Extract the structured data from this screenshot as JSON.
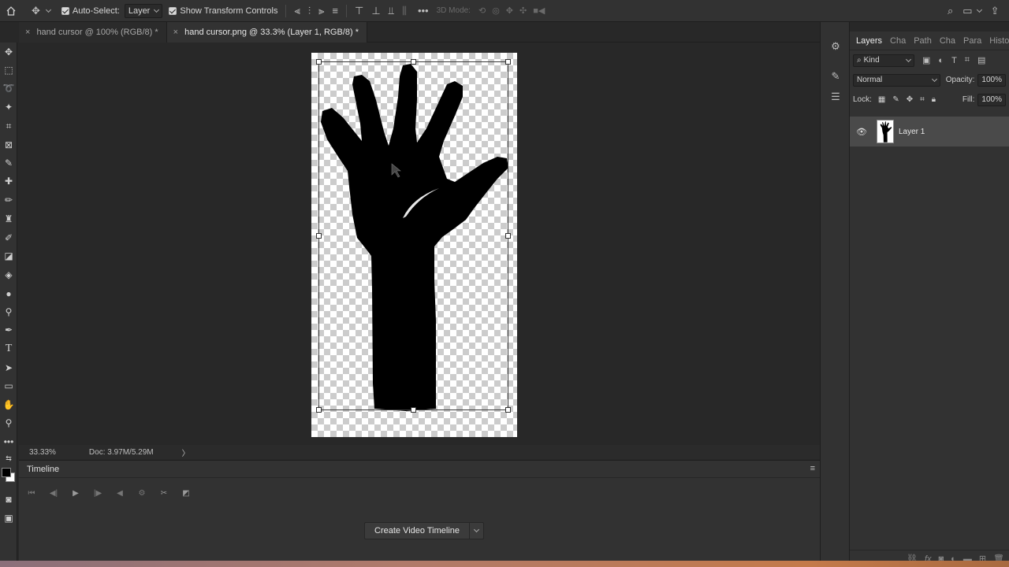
{
  "options_bar": {
    "auto_select_label": "Auto-Select:",
    "auto_select_value": "Layer",
    "transform_controls_label": "Show Transform Controls",
    "mode_3d_label": "3D Mode:"
  },
  "tabs": [
    {
      "label": "hand cursor @ 100% (RGB/8) *"
    },
    {
      "label": "hand cursor.png @ 33.3% (Layer 1, RGB/8) *"
    }
  ],
  "status": {
    "zoom": "33.33%",
    "doc": "Doc: 3.97M/5.29M",
    "arrow": "〉"
  },
  "timeline": {
    "title": "Timeline",
    "create_button": "Create Video Timeline"
  },
  "layers_panel": {
    "tabs": [
      "Layers",
      "Cha",
      "Path",
      "Cha",
      "Para",
      "Histo"
    ],
    "filter_kind": "Kind",
    "blend_mode": "Normal",
    "opacity_label": "Opacity:",
    "opacity_value": "100%",
    "lock_label": "Lock:",
    "fill_label": "Fill:",
    "fill_value": "100%",
    "layers": [
      {
        "name": "Layer 1",
        "visible": true
      }
    ]
  },
  "colors": {
    "foreground": "#000000",
    "background": "#ffffff",
    "accent": "#4a4a4a"
  }
}
